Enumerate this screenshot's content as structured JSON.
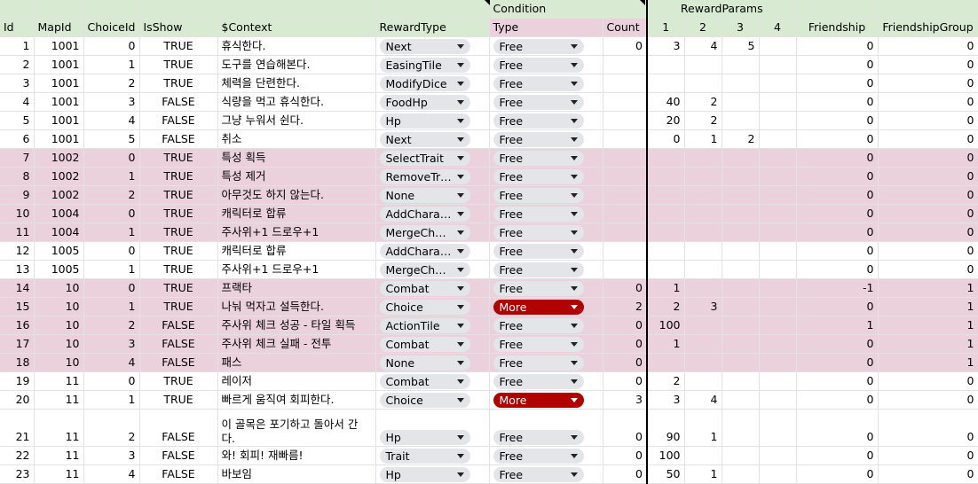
{
  "header_groups": {
    "condition": "Condition",
    "reward_params": "RewardParams"
  },
  "columns": [
    "Id",
    "MapId",
    "ChoiceId",
    "IsShow",
    "$Context",
    "RewardType",
    "Type",
    "Count",
    "1",
    "2",
    "3",
    "4",
    "Friendship",
    "FriendshipGroup"
  ],
  "rows": [
    {
      "id": "1",
      "mapId": "1001",
      "choiceId": "0",
      "isShow": "TRUE",
      "context": "휴식한다.",
      "rewardType": "Next",
      "type": "Free",
      "count": "0",
      "p1": "3",
      "p2": "4",
      "p3": "5",
      "p4": "",
      "friendship": "0",
      "group": "0",
      "pink": false
    },
    {
      "id": "2",
      "mapId": "1001",
      "choiceId": "1",
      "isShow": "TRUE",
      "context": "도구를 연습해본다.",
      "rewardType": "EasingTile",
      "type": "Free",
      "count": "",
      "p1": "",
      "p2": "",
      "p3": "",
      "p4": "",
      "friendship": "0",
      "group": "0",
      "pink": false
    },
    {
      "id": "3",
      "mapId": "1001",
      "choiceId": "2",
      "isShow": "TRUE",
      "context": "체력을 단련한다.",
      "rewardType": "ModifyDice",
      "type": "Free",
      "count": "",
      "p1": "",
      "p2": "",
      "p3": "",
      "p4": "",
      "friendship": "0",
      "group": "0",
      "pink": false
    },
    {
      "id": "4",
      "mapId": "1001",
      "choiceId": "3",
      "isShow": "FALSE",
      "context": "식량을 먹고 휴식한다.",
      "rewardType": "FoodHp",
      "type": "Free",
      "count": "",
      "p1": "40",
      "p2": "2",
      "p3": "",
      "p4": "",
      "friendship": "0",
      "group": "0",
      "pink": false
    },
    {
      "id": "5",
      "mapId": "1001",
      "choiceId": "4",
      "isShow": "FALSE",
      "context": "그냥 누워서 쉰다.",
      "rewardType": "Hp",
      "type": "Free",
      "count": "",
      "p1": "20",
      "p2": "2",
      "p3": "",
      "p4": "",
      "friendship": "0",
      "group": "0",
      "pink": false
    },
    {
      "id": "6",
      "mapId": "1001",
      "choiceId": "5",
      "isShow": "FALSE",
      "context": "취소",
      "rewardType": "Next",
      "type": "Free",
      "count": "",
      "p1": "0",
      "p2": "1",
      "p3": "2",
      "p4": "",
      "friendship": "0",
      "group": "0",
      "pink": false
    },
    {
      "id": "7",
      "mapId": "1002",
      "choiceId": "0",
      "isShow": "TRUE",
      "context": "특성 획득",
      "rewardType": "SelectTrait",
      "type": "Free",
      "count": "",
      "p1": "",
      "p2": "",
      "p3": "",
      "p4": "",
      "friendship": "0",
      "group": "0",
      "pink": true
    },
    {
      "id": "8",
      "mapId": "1002",
      "choiceId": "1",
      "isShow": "TRUE",
      "context": "특성 제거",
      "rewardType": "RemoveTrait",
      "type": "Free",
      "count": "",
      "p1": "",
      "p2": "",
      "p3": "",
      "p4": "",
      "friendship": "0",
      "group": "0",
      "pink": true
    },
    {
      "id": "9",
      "mapId": "1002",
      "choiceId": "2",
      "isShow": "TRUE",
      "context": "아무것도 하지 않는다.",
      "rewardType": "None",
      "type": "Free",
      "count": "",
      "p1": "",
      "p2": "",
      "p3": "",
      "p4": "",
      "friendship": "0",
      "group": "0",
      "pink": true
    },
    {
      "id": "10",
      "mapId": "1004",
      "choiceId": "0",
      "isShow": "TRUE",
      "context": "캐릭터로 합류",
      "rewardType": "AddCharacter",
      "type": "Free",
      "count": "",
      "p1": "",
      "p2": "",
      "p3": "",
      "p4": "",
      "friendship": "0",
      "group": "0",
      "pink": true
    },
    {
      "id": "11",
      "mapId": "1004",
      "choiceId": "1",
      "isShow": "TRUE",
      "context": "주사위+1 드로우+1",
      "rewardType": "MergeChar…",
      "type": "Free",
      "count": "",
      "p1": "",
      "p2": "",
      "p3": "",
      "p4": "",
      "friendship": "0",
      "group": "0",
      "pink": true
    },
    {
      "id": "12",
      "mapId": "1005",
      "choiceId": "0",
      "isShow": "TRUE",
      "context": "캐릭터로 합류",
      "rewardType": "AddCharacter",
      "type": "Free",
      "count": "",
      "p1": "",
      "p2": "",
      "p3": "",
      "p4": "",
      "friendship": "0",
      "group": "0",
      "pink": false
    },
    {
      "id": "13",
      "mapId": "1005",
      "choiceId": "1",
      "isShow": "TRUE",
      "context": "주사위+1 드로우+1",
      "rewardType": "MergeChar…",
      "type": "Free",
      "count": "",
      "p1": "",
      "p2": "",
      "p3": "",
      "p4": "",
      "friendship": "0",
      "group": "0",
      "pink": false
    },
    {
      "id": "14",
      "mapId": "10",
      "choiceId": "0",
      "isShow": "TRUE",
      "context": "프랙타",
      "rewardType": "Combat",
      "type": "Free",
      "count": "0",
      "p1": "1",
      "p2": "",
      "p3": "",
      "p4": "",
      "friendship": "-1",
      "group": "1",
      "pink": true
    },
    {
      "id": "15",
      "mapId": "10",
      "choiceId": "1",
      "isShow": "TRUE",
      "context": "나눠 먹자고 설득한다.",
      "rewardType": "Choice",
      "type": "More",
      "count": "2",
      "p1": "2",
      "p2": "3",
      "p3": "",
      "p4": "",
      "friendship": "0",
      "group": "1",
      "pink": true
    },
    {
      "id": "16",
      "mapId": "10",
      "choiceId": "2",
      "isShow": "FALSE",
      "context": "주사위 체크 성공 - 타일 획득",
      "rewardType": "ActionTile",
      "type": "Free",
      "count": "0",
      "p1": "100",
      "p2": "",
      "p3": "",
      "p4": "",
      "friendship": "1",
      "group": "1",
      "pink": true
    },
    {
      "id": "17",
      "mapId": "10",
      "choiceId": "3",
      "isShow": "FALSE",
      "context": "주사위 체크 실패 - 전투",
      "rewardType": "Combat",
      "type": "Free",
      "count": "0",
      "p1": "1",
      "p2": "",
      "p3": "",
      "p4": "",
      "friendship": "0",
      "group": "1",
      "pink": true
    },
    {
      "id": "18",
      "mapId": "10",
      "choiceId": "4",
      "isShow": "FALSE",
      "context": "패스",
      "rewardType": "None",
      "type": "Free",
      "count": "0",
      "p1": "",
      "p2": "",
      "p3": "",
      "p4": "",
      "friendship": "0",
      "group": "1",
      "pink": true
    },
    {
      "id": "19",
      "mapId": "11",
      "choiceId": "0",
      "isShow": "TRUE",
      "context": "레이저",
      "rewardType": "Combat",
      "type": "Free",
      "count": "0",
      "p1": "2",
      "p2": "",
      "p3": "",
      "p4": "",
      "friendship": "0",
      "group": "0",
      "pink": false
    },
    {
      "id": "20",
      "mapId": "11",
      "choiceId": "1",
      "isShow": "TRUE",
      "context": "빠르게 움직여 회피한다.",
      "rewardType": "Choice",
      "type": "More",
      "count": "3",
      "p1": "3",
      "p2": "4",
      "p3": "",
      "p4": "",
      "friendship": "0",
      "group": "0",
      "pink": false
    },
    {
      "id": "21",
      "mapId": "11",
      "choiceId": "2",
      "isShow": "FALSE",
      "context": "이 골목은 포기하고 돌아서 간다.",
      "rewardType": "Hp",
      "type": "Free",
      "count": "0",
      "p1": "90",
      "p2": "1",
      "p3": "",
      "p4": "",
      "friendship": "0",
      "group": "0",
      "pink": false,
      "tall": true
    },
    {
      "id": "22",
      "mapId": "11",
      "choiceId": "3",
      "isShow": "FALSE",
      "context": "와! 회피! 재빠름!",
      "rewardType": "Trait",
      "type": "Free",
      "count": "0",
      "p1": "100",
      "p2": "",
      "p3": "",
      "p4": "",
      "friendship": "0",
      "group": "0",
      "pink": false
    },
    {
      "id": "23",
      "mapId": "11",
      "choiceId": "4",
      "isShow": "FALSE",
      "context": "바보임",
      "rewardType": "Hp",
      "type": "Free",
      "count": "0",
      "p1": "50",
      "p2": "1",
      "p3": "",
      "p4": "",
      "friendship": "0",
      "group": "0",
      "pink": false
    }
  ]
}
